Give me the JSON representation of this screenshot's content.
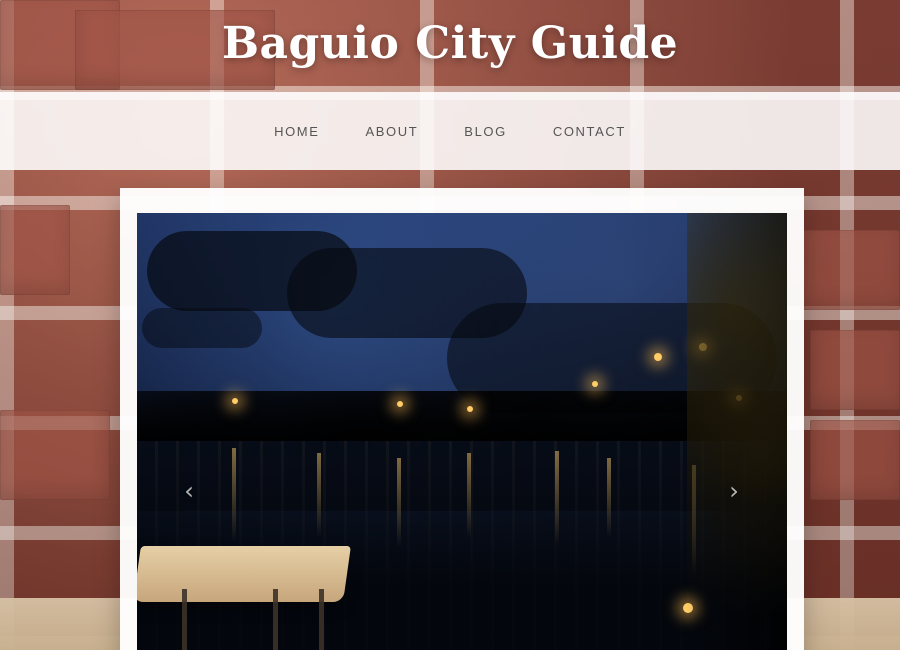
{
  "header": {
    "site_title": "Baguio City Guide"
  },
  "nav": {
    "items": [
      {
        "label": "HOME"
      },
      {
        "label": "ABOUT"
      },
      {
        "label": "BLOG"
      },
      {
        "label": "CONTACT"
      }
    ]
  },
  "hero": {
    "prev_glyph": "‹",
    "next_glyph": "›"
  },
  "icons": {
    "prev": "chevron-left-icon",
    "next": "chevron-right-icon"
  },
  "colors": {
    "nav_bg": "#ffffff",
    "nav_text": "#555555",
    "title": "#ffffff"
  }
}
